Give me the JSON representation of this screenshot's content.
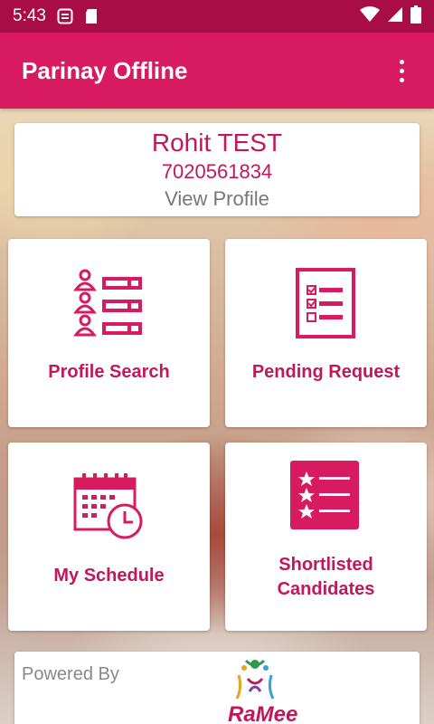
{
  "status_bar": {
    "time": "5:43",
    "icons": [
      "sync-icon",
      "sd-card-icon",
      "wifi-icon",
      "signal-icon",
      "battery-icon"
    ]
  },
  "app_bar": {
    "title": "Parinay Offline",
    "menu_icon": "overflow-menu-icon"
  },
  "profile": {
    "name": "Rohit TEST",
    "phone": "7020561834",
    "view_link": "View Profile"
  },
  "tiles": [
    {
      "label": "Profile Search",
      "icon": "profile-search-icon"
    },
    {
      "label": "Pending Request",
      "icon": "checklist-icon"
    },
    {
      "label": "My Schedule",
      "icon": "calendar-clock-icon"
    },
    {
      "label": "Shortlisted\nCandidates",
      "icon": "starred-list-icon"
    }
  ],
  "footer": {
    "powered_by": "Powered By",
    "logo_text": "RaMee"
  },
  "colors": {
    "status_bar": "#a80d46",
    "app_bar": "#d81b60",
    "accent": "#c2185b"
  }
}
